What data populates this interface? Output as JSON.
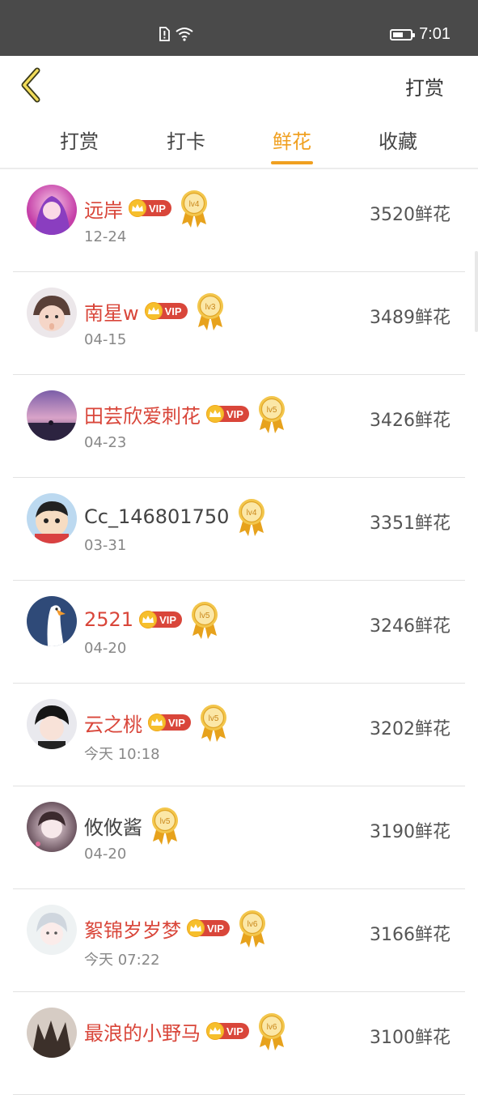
{
  "status_bar": {
    "time": "7:01",
    "battery_level": 0.6,
    "icons": [
      "sim-alert-icon",
      "wifi-icon",
      "battery-icon"
    ]
  },
  "header": {
    "back_icon": "chevron-left-icon",
    "action_label": "打赏"
  },
  "tabs": [
    {
      "label": "打赏",
      "active": false
    },
    {
      "label": "打卡",
      "active": false
    },
    {
      "label": "鲜花",
      "active": true
    },
    {
      "label": "收藏",
      "active": false
    }
  ],
  "colors": {
    "accent": "#f0a020",
    "vip_name": "#d9463a",
    "status_bar_bg": "#4a4a4a"
  },
  "rows": [
    {
      "name": "远岸",
      "vip": true,
      "vip_text": "VIP",
      "level": "lv4",
      "date": "12-24",
      "amount": "3520鲜花"
    },
    {
      "name": "南星w",
      "vip": true,
      "vip_text": "VIP",
      "level": "lv3",
      "date": "04-15",
      "amount": "3489鲜花"
    },
    {
      "name": "田芸欣爱刺花",
      "vip": true,
      "vip_text": "VIP",
      "level": "lv5",
      "date": "04-23",
      "amount": "3426鲜花"
    },
    {
      "name": "Cc_146801750",
      "vip": false,
      "vip_text": "",
      "level": "lv4",
      "date": "03-31",
      "amount": "3351鲜花"
    },
    {
      "name": "2521",
      "vip": true,
      "vip_text": "VIP",
      "level": "lv5",
      "date": "04-20",
      "amount": "3246鲜花"
    },
    {
      "name": "云之桃",
      "vip": true,
      "vip_text": "VIP",
      "level": "lv5",
      "date": "今天 10:18",
      "amount": "3202鲜花"
    },
    {
      "name": "攸攸酱",
      "vip": false,
      "vip_text": "",
      "level": "lv5",
      "date": "04-20",
      "amount": "3190鲜花"
    },
    {
      "name": "絮锦岁岁梦",
      "vip": true,
      "vip_text": "VIP",
      "level": "lv6",
      "date": "今天 07:22",
      "amount": "3166鲜花"
    },
    {
      "name": "最浪的小野马",
      "vip": true,
      "vip_text": "VIP",
      "level": "lv6",
      "date": "",
      "amount": "3100鲜花"
    }
  ]
}
